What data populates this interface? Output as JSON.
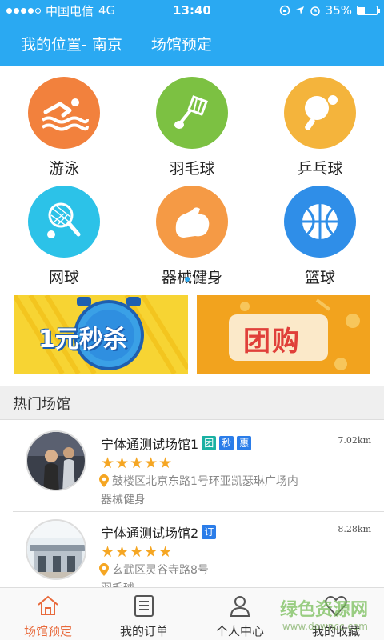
{
  "status": {
    "carrier": "中国电信",
    "network": "4G",
    "time": "13:40",
    "battery": "35%",
    "battery_fraction": 0.35
  },
  "header": {
    "location": "我的位置- 南京",
    "title": "场馆预定"
  },
  "categories": [
    {
      "label": "游泳",
      "icon": "swimming-icon",
      "color": "#f2813d"
    },
    {
      "label": "羽毛球",
      "icon": "badminton-icon",
      "color": "#7cc142"
    },
    {
      "label": "乒乓球",
      "icon": "table-tennis-icon",
      "color": "#f4b43c"
    },
    {
      "label": "网球",
      "icon": "tennis-icon",
      "color": "#2cc2e8"
    },
    {
      "label": "器械健身",
      "icon": "fitness-icon",
      "color": "#f59a45"
    },
    {
      "label": "篮球",
      "icon": "basketball-icon",
      "color": "#2f8ee8"
    }
  ],
  "pager": {
    "pages": 2,
    "active": 0
  },
  "banners": {
    "left_text": "1元秒杀",
    "right_text": "团购"
  },
  "hot": {
    "title": "热门场馆"
  },
  "venues": [
    {
      "name": "宁体通测试场馆1",
      "tags": [
        "团",
        "秒",
        "惠"
      ],
      "distance": "7.02km",
      "rating": 5,
      "stars": "★★★★★",
      "address": "鼓楼区北京东路1号环亚凯瑟琳广场内",
      "type": "器械健身"
    },
    {
      "name": "宁体通测试场馆2",
      "tags": [
        "订"
      ],
      "distance": "8.28km",
      "rating": 5,
      "stars": "★★★★★",
      "address": "玄武区灵谷寺路8号",
      "type": "羽毛球"
    }
  ],
  "tabs": [
    {
      "label": "场馆预定",
      "icon": "home-icon",
      "active": true
    },
    {
      "label": "我的订单",
      "icon": "order-icon",
      "active": false
    },
    {
      "label": "个人中心",
      "icon": "user-icon",
      "active": false
    },
    {
      "label": "我的收藏",
      "icon": "heart-icon",
      "active": false
    }
  ],
  "watermark": {
    "title": "绿色资源网",
    "url": "www.downcc.com"
  },
  "colors": {
    "primary": "#2aa9f2",
    "tab_active": "#e86a3c",
    "star": "#f5a623"
  }
}
